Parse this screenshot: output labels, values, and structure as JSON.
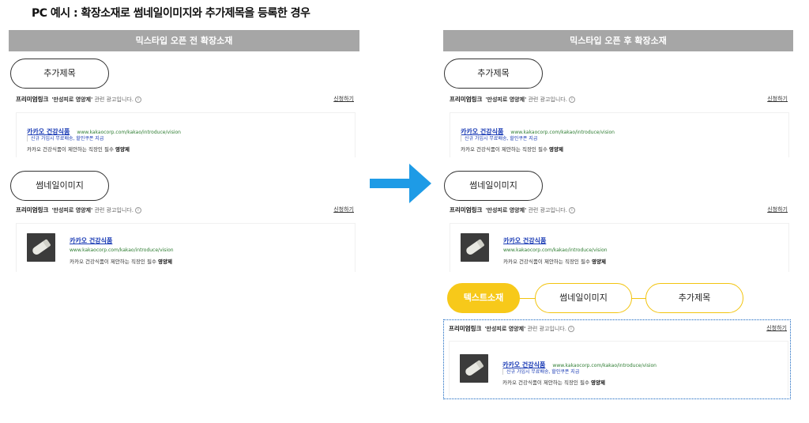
{
  "page_title": "PC 예시 : 확장소재로 썸네일이미지와 추가제목을 등록한 경우",
  "left_panel": {
    "header": "믹스타입 오픈 전 확장소재",
    "pill_add_title": "추가제목",
    "pill_thumbnail": "썸네일이미지"
  },
  "right_panel": {
    "header": "믹스타입 오픈 후 확장소재",
    "pill_add_title": "추가제목",
    "pill_thumbnail": "썸네일이미지",
    "steps": [
      "텍스트소재",
      "썸네일이미지",
      "추가제목"
    ]
  },
  "ad": {
    "brand": "프리미엄링크",
    "query_quoted": "'만성피로 영양제'",
    "query_suffix": " 관련 광고입니다.",
    "info": "i",
    "apply": "신청하기",
    "title": "카카오 건강식품",
    "url": "www.kakaocorp.com/kakao/introduce/vision",
    "sub": "신규 가입시 무료배송, 할인쿠폰 지급",
    "desc_prefix": "카카오 건강식품이 제안하는 직장인 필수 ",
    "desc_bold": "영양제"
  },
  "colors": {
    "arrow": "#1e9be6",
    "step_active": "#f7c91a",
    "step_border": "#f2c40f",
    "dotted_border": "#1565c0",
    "header_bg": "#a6a6a6"
  }
}
